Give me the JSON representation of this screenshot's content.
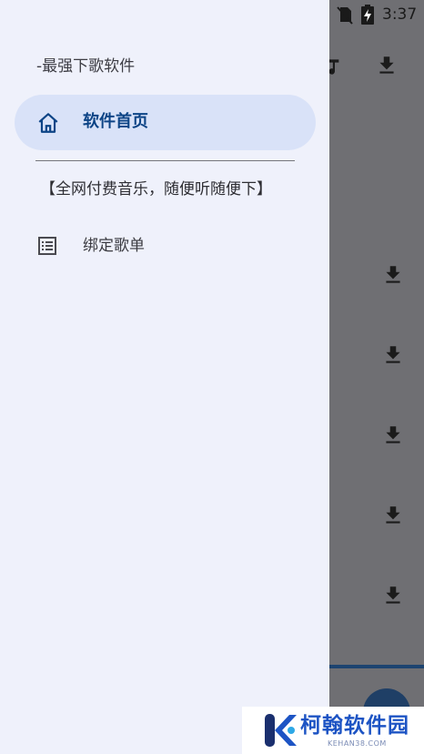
{
  "status_bar": {
    "time": "3:37",
    "icons": [
      "wifi-icon",
      "no-sim-icon",
      "battery-charging-icon"
    ]
  },
  "drawer": {
    "subtitle": "-最强下歌软件",
    "nav_home_label": "软件首页",
    "promo_text": "【全网付费音乐，随便听随便下】",
    "nav_bind_label": "绑定歌单"
  },
  "background_app": {
    "icons": [
      "music-note-icon",
      "download-icon"
    ]
  },
  "watermark": {
    "title": "柯翰软件园",
    "subtitle": "KEHAN38.COM"
  },
  "colors": {
    "drawer_bg": "#eff1fb",
    "active_item_bg": "#d9e2f8",
    "accent": "#0d4486",
    "scrim": "#6f6f73"
  }
}
